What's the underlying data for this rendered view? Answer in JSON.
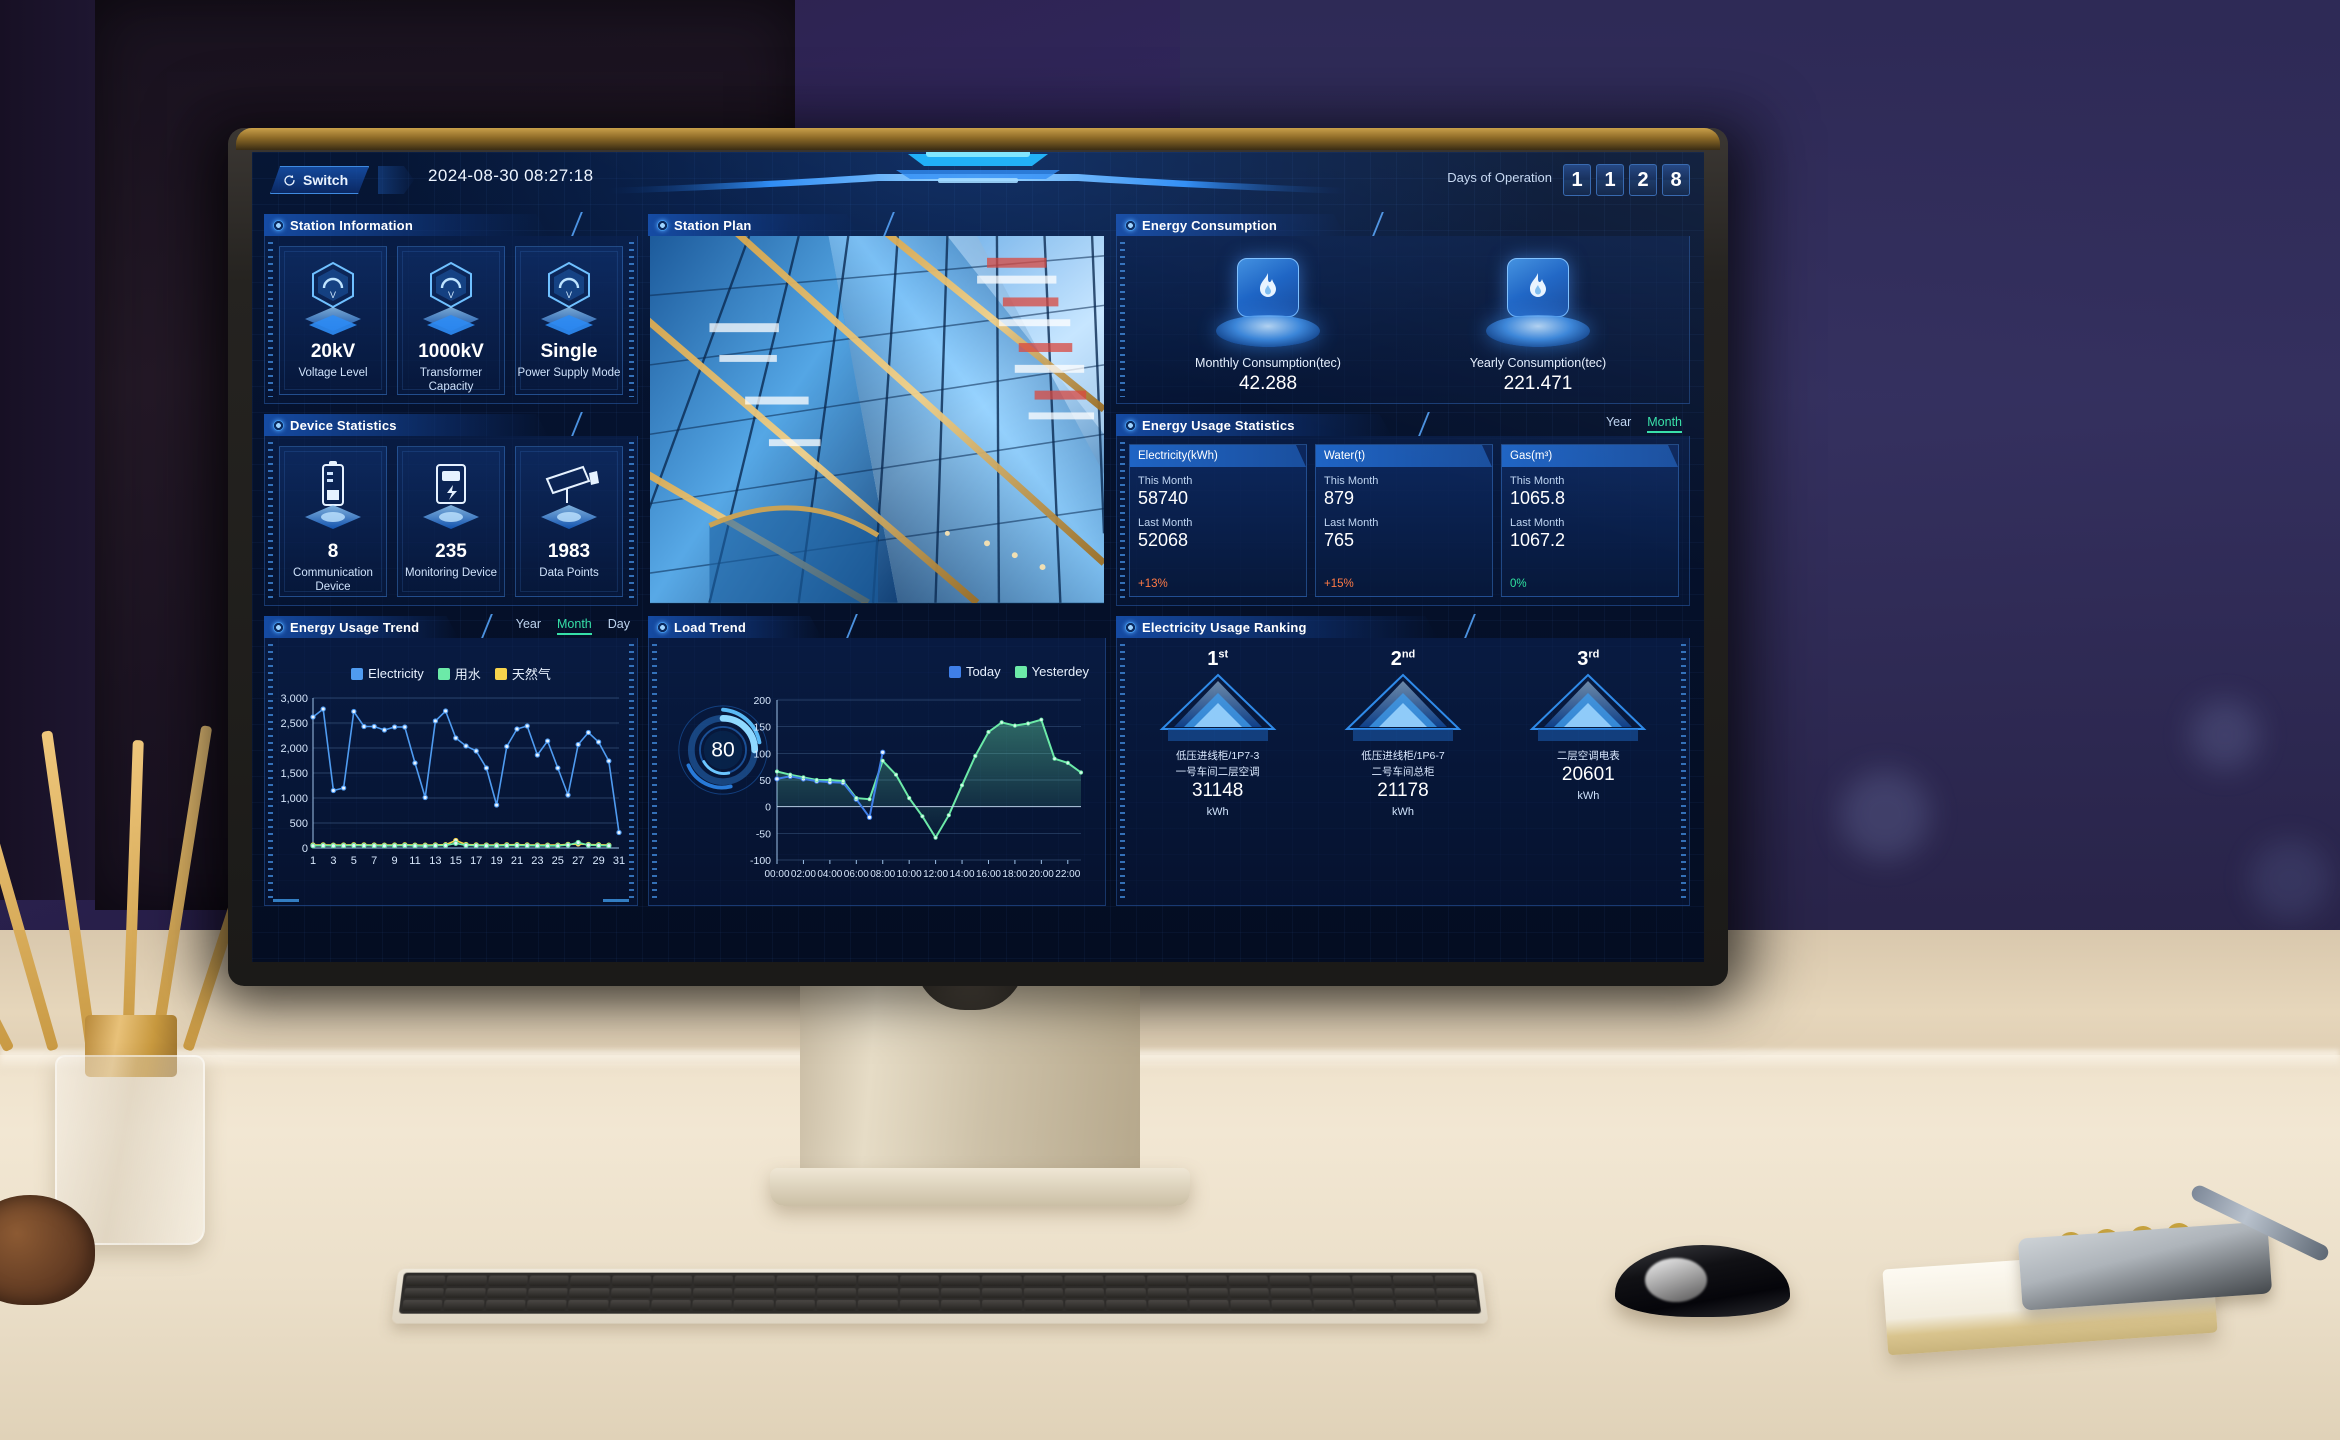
{
  "topbar": {
    "switch_label": "Switch",
    "switch_icon": "refresh-icon",
    "datetime": "2024-08-30 08:27:18",
    "days_label": "Days of Operation",
    "days_digits": [
      "1",
      "1",
      "2",
      "8"
    ]
  },
  "station_information": {
    "title": "Station Information",
    "cards": [
      {
        "value": "20kV",
        "label": "Voltage Level",
        "icon": "voltage-meter-icon"
      },
      {
        "value": "1000kV",
        "label": "Transformer Capacity",
        "icon": "voltage-meter-icon"
      },
      {
        "value": "Single",
        "label": "Power Supply Mode",
        "icon": "voltage-meter-icon"
      }
    ]
  },
  "device_statistics": {
    "title": "Device Statistics",
    "cards": [
      {
        "value": "8",
        "label": "Communication Device",
        "icon": "communication-device-icon"
      },
      {
        "value": "235",
        "label": "Monitoring Device",
        "icon": "meter-box-icon"
      },
      {
        "value": "1983",
        "label": "Data Points",
        "icon": "cctv-camera-icon"
      }
    ]
  },
  "station_plan": {
    "title": "Station Plan",
    "image_alt": "glass-office-tower-photo"
  },
  "energy_consumption": {
    "title": "Energy Consumption",
    "items": [
      {
        "label": "Monthly Consumption(tec)",
        "value": "42.288",
        "icon": "flame-icon"
      },
      {
        "label": "Yearly Consumption(tec)",
        "value": "221.471",
        "icon": "flame-icon"
      }
    ]
  },
  "energy_usage_statistics": {
    "title": "Energy Usage Statistics",
    "tabs": [
      {
        "label": "Year",
        "active": false
      },
      {
        "label": "Month",
        "active": true
      }
    ],
    "this_month_label": "This Month",
    "last_month_label": "Last Month",
    "cards": [
      {
        "header": "Electricity(kWh)",
        "this_month": "58740",
        "last_month": "52068",
        "delta": "+13%",
        "delta_color": "#ff7a45"
      },
      {
        "header": "Water(t)",
        "this_month": "879",
        "last_month": "765",
        "delta": "+15%",
        "delta_color": "#ff7a45"
      },
      {
        "header": "Gas(m³)",
        "this_month": "1065.8",
        "last_month": "1067.2",
        "delta": "0%",
        "delta_color": "#2fe3a0"
      }
    ]
  },
  "energy_usage_trend": {
    "title": "Energy Usage Trend",
    "tabs": [
      {
        "label": "Year",
        "active": false
      },
      {
        "label": "Month",
        "active": true
      },
      {
        "label": "Day",
        "active": false
      }
    ]
  },
  "load_trend": {
    "title": "Load Trend",
    "gauge_value": "80"
  },
  "electricity_usage_ranking": {
    "title": "Electricity Usage Ranking",
    "unit": "kWh",
    "items": [
      {
        "rank": "1",
        "rank_suffix": "st",
        "name_line1": "低压进线柜/1P7-3",
        "name_line2": "一号车间二层空调",
        "value": "31148"
      },
      {
        "rank": "2",
        "rank_suffix": "nd",
        "name_line1": "低压进线柜/1P6-7",
        "name_line2": "二号车间总柜",
        "value": "21178"
      },
      {
        "rank": "3",
        "rank_suffix": "rd",
        "name_line1": "二层空调电表",
        "name_line2": "",
        "value": "20601"
      }
    ]
  },
  "colors": {
    "accent_blue": "#3f93e8",
    "electricity": "#4f9bf0",
    "water": "#6ceaa8",
    "gas": "#f7d44c",
    "today": "#3f7fe8",
    "yesterday": "#6ceaa8",
    "active_tab": "#36e0a8",
    "up": "#ff7a45",
    "flat": "#2fe3a0"
  },
  "chart_data": [
    {
      "type": "line",
      "id": "energy-usage-trend-chart",
      "title": "Energy Usage Trend",
      "xlabel": "",
      "ylabel": "",
      "ylim": [
        0,
        3000
      ],
      "yticks": [
        0,
        500,
        1000,
        1500,
        2000,
        2500,
        3000
      ],
      "ytick_labels": [
        "0",
        "500",
        "1,000",
        "1,500",
        "2,000",
        "2,500",
        "3,000"
      ],
      "grid": true,
      "legend_position": "top-center",
      "x": [
        1,
        2,
        3,
        4,
        5,
        6,
        7,
        8,
        9,
        10,
        11,
        12,
        13,
        14,
        15,
        16,
        17,
        18,
        19,
        20,
        21,
        22,
        23,
        24,
        25,
        26,
        27,
        28,
        29,
        30
      ],
      "xtick_labels": [
        "1",
        "3",
        "5",
        "7",
        "9",
        "11",
        "13",
        "15",
        "17",
        "19",
        "21",
        "23",
        "25",
        "27",
        "29",
        "31"
      ],
      "series": [
        {
          "name": "Electricity",
          "color": "#4f9bf0",
          "values": [
            2620,
            2780,
            1150,
            1200,
            2730,
            2430,
            2430,
            2360,
            2420,
            2420,
            1700,
            1010,
            2540,
            2740,
            2200,
            2040,
            1940,
            1600,
            860,
            2030,
            2380,
            2440,
            1860,
            2140,
            1600,
            1060,
            2070,
            2310,
            2120,
            1740,
            310
          ]
        },
        {
          "name": "用水",
          "color": "#6ceaa8",
          "values": [
            45,
            48,
            44,
            46,
            50,
            48,
            47,
            45,
            46,
            50,
            44,
            42,
            48,
            52,
            95,
            55,
            48,
            46,
            47,
            50,
            52,
            48,
            46,
            45,
            44,
            60,
            110,
            58,
            50,
            46
          ]
        },
        {
          "name": "天然气",
          "color": "#f7d44c",
          "values": [
            60,
            62,
            58,
            60,
            64,
            62,
            60,
            58,
            60,
            64,
            58,
            56,
            62,
            66,
            150,
            70,
            62,
            60,
            60,
            64,
            66,
            62,
            60,
            58,
            58,
            72,
            80,
            70,
            64,
            58
          ]
        }
      ]
    },
    {
      "type": "line",
      "id": "load-trend-chart",
      "title": "Load Trend",
      "xlabel": "",
      "ylabel": "",
      "ylim": [
        -100,
        200
      ],
      "yticks": [
        -100,
        -50,
        0,
        50,
        100,
        150,
        200
      ],
      "ytick_labels": [
        "-100",
        "-50",
        "0",
        "50",
        "100",
        "150",
        "200"
      ],
      "grid": true,
      "legend_position": "top-right",
      "xtick_labels": [
        "00:00",
        "02:00",
        "04:00",
        "06:00",
        "08:00",
        "10:00",
        "12:00",
        "14:00",
        "16:00",
        "18:00",
        "20:00",
        "22:00"
      ],
      "x": [
        0,
        1,
        2,
        3,
        4,
        5,
        6,
        7,
        8,
        9,
        10,
        11,
        12,
        13,
        14,
        15,
        16,
        17,
        18,
        19,
        20,
        21,
        22,
        23
      ],
      "series": [
        {
          "name": "Today",
          "color": "#3f7fe8",
          "values": [
            52,
            57,
            52,
            48,
            46,
            45,
            14,
            -20,
            102,
            null,
            null,
            null,
            null,
            null,
            null,
            null,
            null,
            null,
            null,
            null,
            null,
            null,
            null,
            null
          ]
        },
        {
          "name": "Yesterdey",
          "color": "#6ceaa8",
          "values": [
            66,
            60,
            55,
            50,
            50,
            48,
            16,
            14,
            86,
            60,
            16,
            -18,
            -58,
            -16,
            40,
            95,
            140,
            158,
            152,
            156,
            163,
            90,
            82,
            64
          ]
        }
      ]
    }
  ]
}
